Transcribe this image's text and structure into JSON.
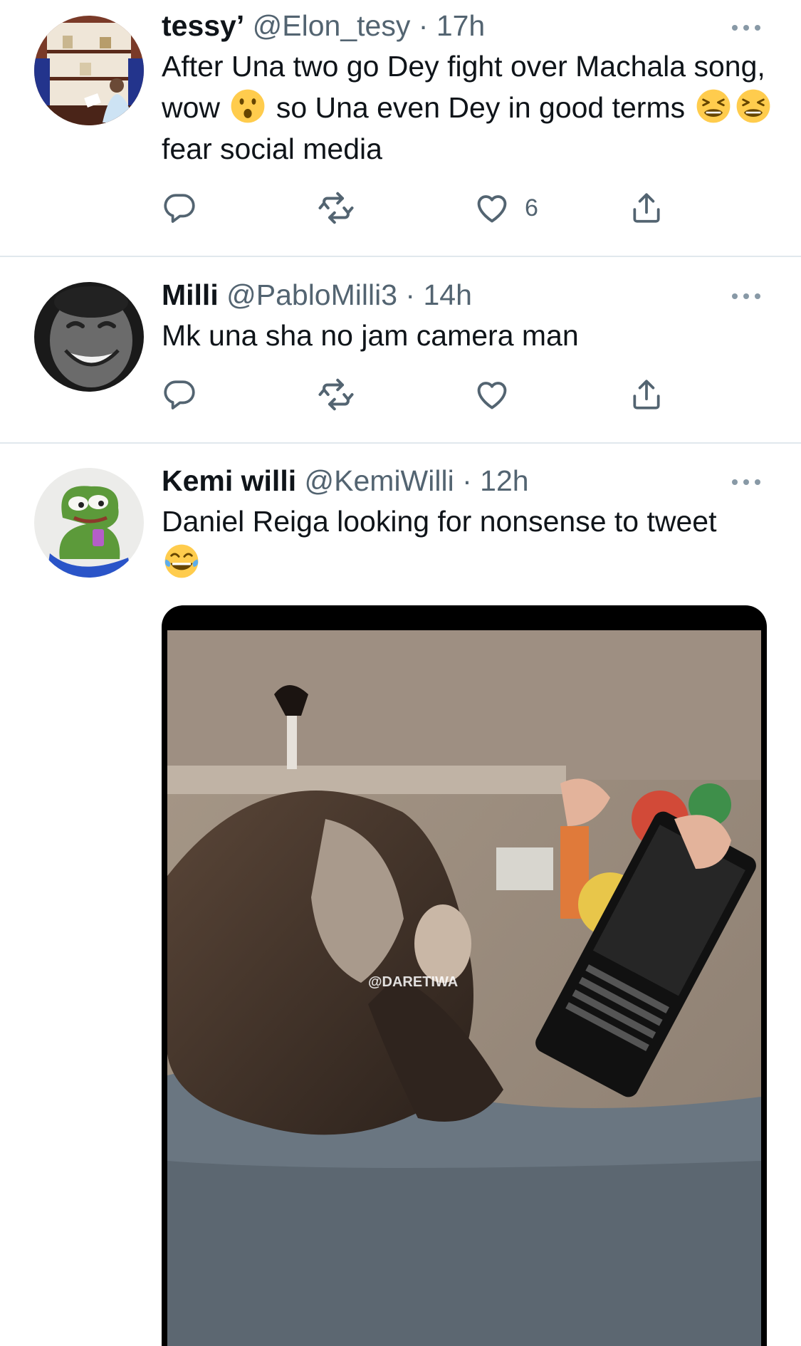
{
  "tweets": [
    {
      "name": "tessy’",
      "handle": "@Elon_tesy",
      "separator": "·",
      "time": "17h",
      "text_parts": [
        "After Una two go Dey fight over Machala song, wow ",
        " so Una even Dey in good terms ",
        "fear social media"
      ],
      "emojis": [
        "hushed-face-emoji",
        "tired-face-emoji",
        "tired-face-emoji"
      ],
      "like_count": "6"
    },
    {
      "name": "Milli",
      "handle": "@PabloMilli3",
      "separator": "·",
      "time": "14h",
      "text": "Mk una sha no jam camera man",
      "like_count": ""
    },
    {
      "name": "Kemi willi",
      "handle": "@KemiWilli",
      "separator": "·",
      "time": "12h",
      "text_parts": [
        "Daniel Reiga looking for nonsense to tweet "
      ],
      "emojis": [
        "tears-of-joy-emoji"
      ],
      "media_watermark": "@DARETIWA"
    }
  ],
  "icons": {
    "reply": "reply-icon",
    "retweet": "retweet-icon",
    "like": "heart-icon",
    "share": "share-icon",
    "more": "more-icon"
  },
  "colors": {
    "secondary_text": "#536471",
    "divider": "#e1e8ed",
    "emoji_yellow": "#ffcc4d"
  }
}
